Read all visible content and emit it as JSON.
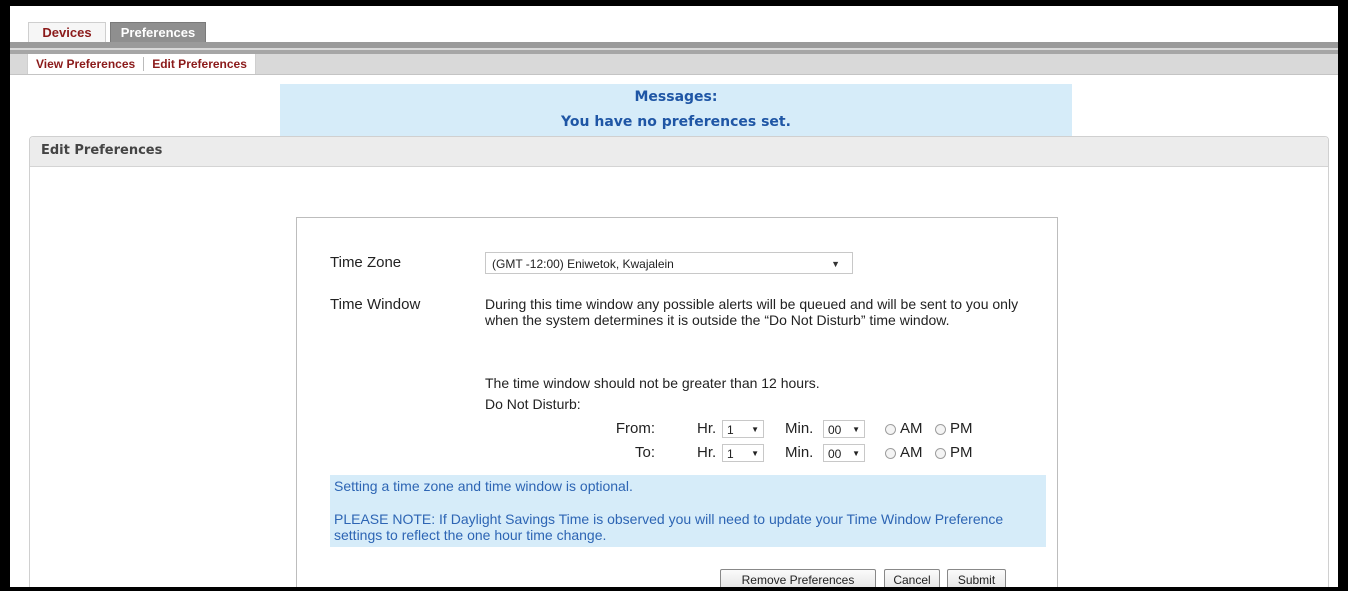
{
  "tabs": {
    "devices": "Devices",
    "preferences": "Preferences"
  },
  "subtabs": {
    "view": "View Preferences",
    "edit": "Edit Preferences"
  },
  "messages": {
    "title": "Messages:",
    "text": "You have no preferences set."
  },
  "panel": {
    "title": "Edit Preferences"
  },
  "form": {
    "time_zone_label": "Time Zone",
    "time_zone_value": "(GMT -12:00) Eniwetok, Kwajalein",
    "time_window_label": "Time Window",
    "description": "During this time window any possible alerts will be queued and will be sent to you only when the system determines it is outside the “Do Not Disturb” time window.",
    "limit_text": "The time window should not be greater than 12 hours.",
    "dnd_label": "Do Not Disturb:",
    "from_label": "From:",
    "to_label": "To:",
    "hr_label": "Hr.",
    "min_label": "Min.",
    "from_hr": "1",
    "from_min": "00",
    "to_hr": "1",
    "to_min": "00",
    "am_label": "AM",
    "pm_label": "PM",
    "note_line1": "Setting a time zone and time window is optional.",
    "note_line2": "PLEASE NOTE: If Daylight Savings Time is observed you will need to update your Time Window Preference settings to reflect the one hour time change."
  },
  "buttons": {
    "remove": "Remove Preferences",
    "cancel": "Cancel",
    "submit": "Submit"
  }
}
